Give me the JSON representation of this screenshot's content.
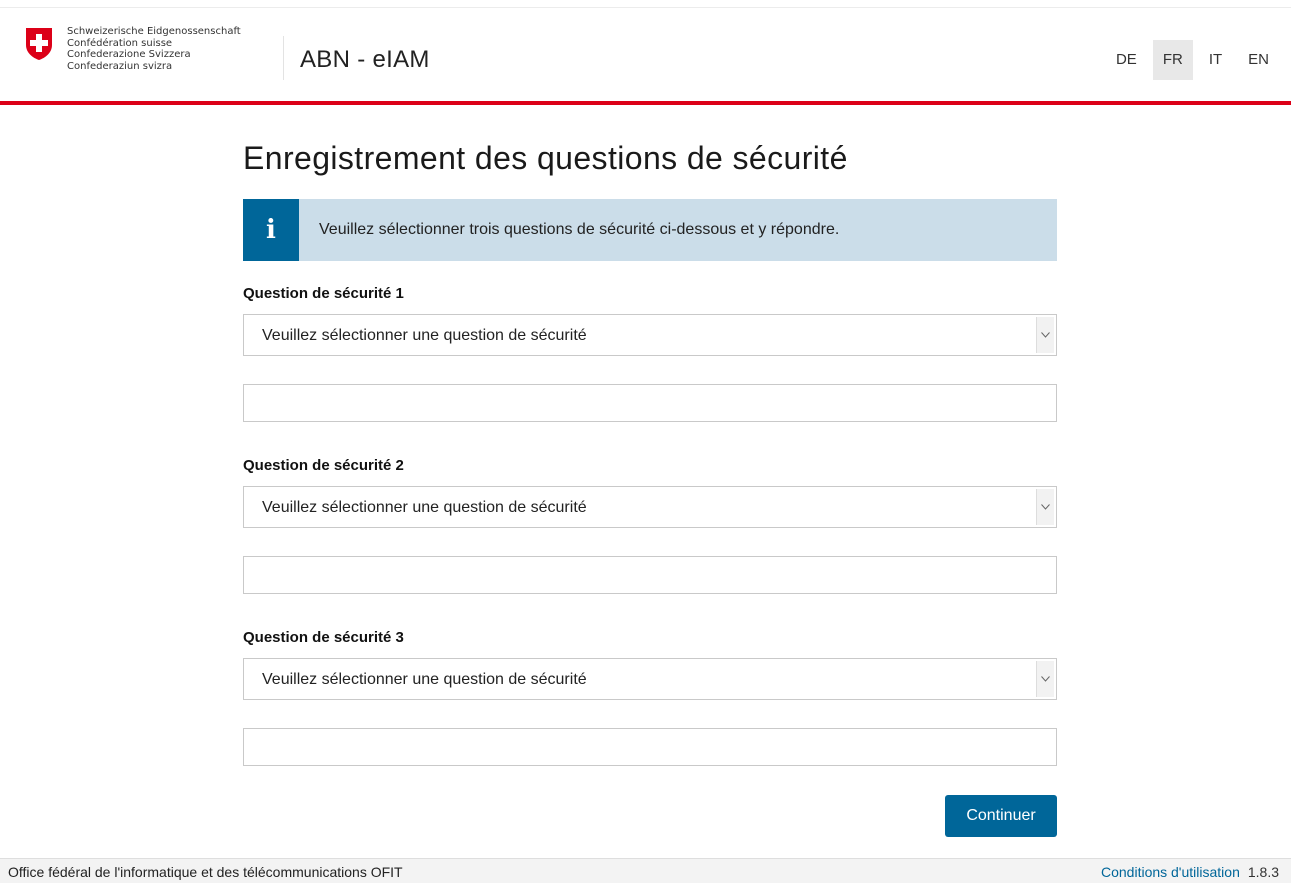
{
  "header": {
    "federal_names": [
      "Schweizerische Eidgenossenschaft",
      "Confédération suisse",
      "Confederazione Svizzera",
      "Confederaziun svizra"
    ],
    "app_title": "ABN - eIAM",
    "languages": [
      {
        "code": "DE",
        "active": false
      },
      {
        "code": "FR",
        "active": true
      },
      {
        "code": "IT",
        "active": false
      },
      {
        "code": "EN",
        "active": false
      }
    ]
  },
  "main": {
    "title": "Enregistrement des questions de sécurité",
    "info": {
      "icon": "i",
      "text": "Veuillez sélectionner trois questions de sécurité ci-dessous et y répondre."
    },
    "questions": [
      {
        "label": "Question de sécurité 1",
        "selected": "Veuillez sélectionner une question de sécurité",
        "answer": ""
      },
      {
        "label": "Question de sécurité 2",
        "selected": "Veuillez sélectionner une question de sécurité",
        "answer": ""
      },
      {
        "label": "Question de sécurité 3",
        "selected": "Veuillez sélectionner une question de sécurité",
        "answer": ""
      }
    ],
    "continue_label": "Continuer"
  },
  "footer": {
    "office": "Office fédéral de l'informatique et des télécommunications OFIT",
    "terms_link": "Conditions d'utilisation",
    "version": "1.8.3"
  },
  "colors": {
    "accent_red": "#dc0018",
    "primary_blue": "#006699",
    "info_bg": "#cbdde9"
  }
}
